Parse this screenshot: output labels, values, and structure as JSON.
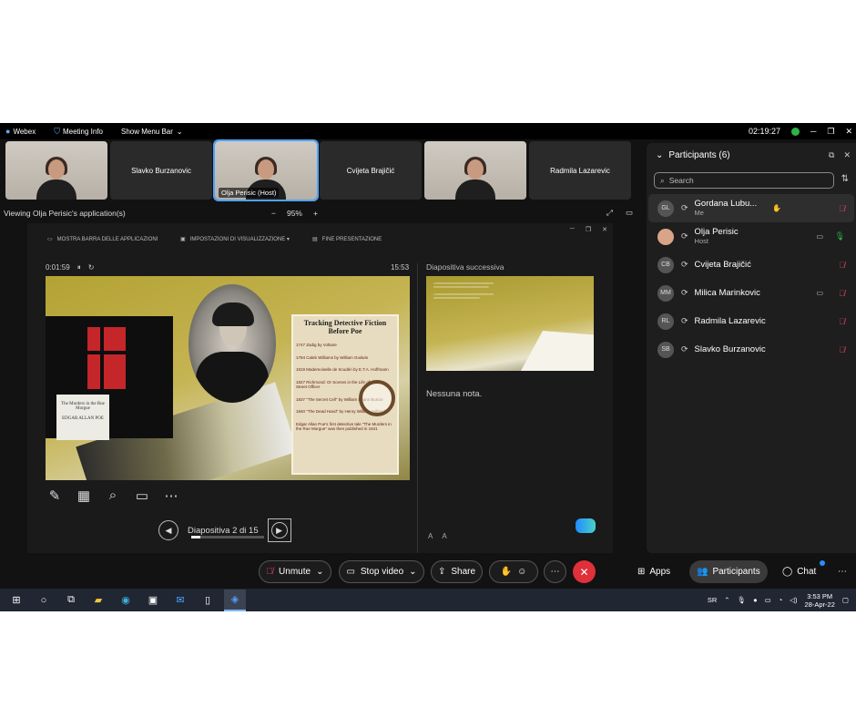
{
  "topbar": {
    "app_name": "Webex",
    "meeting_info": "Meeting Info",
    "show_menu_bar": "Show Menu Bar",
    "timer": "02:19:27"
  },
  "thumbnails": [
    {
      "name": "",
      "video": true
    },
    {
      "name": "Slavko Burzanovic",
      "video": false
    },
    {
      "name": "Olja Perisic (Host)",
      "video": true,
      "active": true
    },
    {
      "name": "Cvijeta Brajičić",
      "video": false
    },
    {
      "name": "",
      "video": true
    },
    {
      "name": "Radmila Lazarevic",
      "video": false
    }
  ],
  "viewing": {
    "title": "Viewing Olja Perisic's application(s)",
    "zoom": "95%"
  },
  "presenter": {
    "menu": [
      "MOSTRA BARRA DELLE APPLICAZIONI",
      "IMPOSTAZIONI DI VISUALIZZAZIONE ▾",
      "FINE PRESENTAZIONE"
    ],
    "elapsed": "0:01:59",
    "clock": "15:53",
    "next_label": "Diapositiva successiva",
    "no_notes": "Nessuna nota.",
    "slide_counter": "Diapositiva 2 di 15",
    "progress": 0.13,
    "slide": {
      "poster_title": "Tracking Detective Fiction Before Poe",
      "book_title": "The Murders in the Rue Morgue",
      "book_author": "EDGAR ALLAN POE",
      "poster_rows": [
        "1747 Zadig by Voltaire",
        "1794 Caleb Williams by William Godwin",
        "1819 Mademoiselle de Scudéri by E.T.A. Hoffmann",
        "1827 Richmond: Or Scenes in the Life of a Bow Street Officer",
        "1837 \"The Secret Cell\" by William Evans Burton",
        "1840 \"The Dead Hand\" by Henry William Holland",
        "Edgar Allan Poe's first detective tale \"The Murders in the Rue Morgue\" was then published in 1841"
      ]
    }
  },
  "participants": {
    "header": "Participants (6)",
    "search_placeholder": "Search",
    "list": [
      {
        "initials": "GL",
        "name": "Gordana Lubu...",
        "sub": "Me",
        "mic": "muted",
        "cam": false,
        "hand": true
      },
      {
        "initials": "",
        "name": "Olja Perisic",
        "sub": "Host",
        "mic": "on",
        "cam": true,
        "hand": false
      },
      {
        "initials": "CB",
        "name": "Cvijeta Brajičić",
        "sub": "",
        "mic": "muted",
        "cam": false,
        "hand": false
      },
      {
        "initials": "MM",
        "name": "Milica Marinkovic",
        "sub": "",
        "mic": "muted",
        "cam": true,
        "hand": false
      },
      {
        "initials": "RL",
        "name": "Radmila Lazarevic",
        "sub": "",
        "mic": "muted",
        "cam": false,
        "hand": false
      },
      {
        "initials": "SB",
        "name": "Slavko Burzanovic",
        "sub": "",
        "mic": "muted",
        "cam": false,
        "hand": false
      }
    ]
  },
  "controls": {
    "unmute": "Unmute",
    "stop_video": "Stop video",
    "share": "Share",
    "apps": "Apps",
    "participants": "Participants",
    "chat": "Chat"
  },
  "taskbar": {
    "lang": "SR",
    "time": "3:53 PM",
    "date": "28-Apr-22"
  },
  "colors": {
    "accent": "#4ea3ff",
    "end_call": "#e0303a",
    "muted": "#e0435f",
    "unmuted": "#2db34a"
  }
}
